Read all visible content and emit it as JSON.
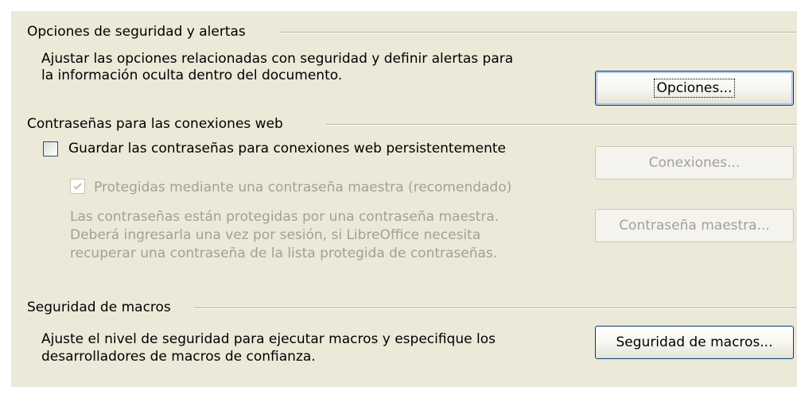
{
  "security_options": {
    "title": "Opciones de seguridad y alertas",
    "description_line1": "Ajustar las opciones relacionadas con seguridad y definir alertas para",
    "description_line2": "la información oculta dentro del documento.",
    "button_label": "Opciones..."
  },
  "web_passwords": {
    "title": "Contraseñas para las conexiones web",
    "persist_checkbox": {
      "label": "Guardar las contraseñas para conexiones web persistentemente",
      "checked": false
    },
    "master_checkbox": {
      "label": "Protegidas mediante una contraseña maestra (recomendado)",
      "checked": true,
      "enabled": false
    },
    "description_line1": "Las contraseñas están protegidas por una contraseña maestra.",
    "description_line2": "Deberá ingresarla una vez por sesión, si LibreOffice necesita",
    "description_line3": "recuperar una contraseña de la lista protegida de contraseñas.",
    "connections_button": "Conexiones...",
    "master_password_button": "Contraseña maestra..."
  },
  "macro_security": {
    "title": "Seguridad de macros",
    "description_line1": "Ajuste el nivel de seguridad para ejecutar macros y especifique los",
    "description_line2": "desarrolladores de macros de confianza.",
    "button_label": "Seguridad de macros..."
  },
  "colors": {
    "panel_background": "#ece9d8",
    "button_border": "#003c74",
    "disabled_text": "#a2a099"
  }
}
